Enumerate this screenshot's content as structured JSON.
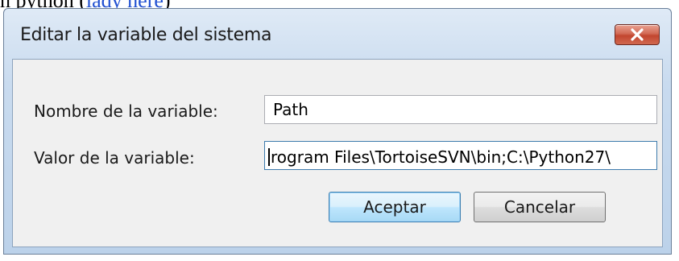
{
  "background": {
    "text_before": "n python (",
    "link_text": "lady here",
    "text_after": ")"
  },
  "dialog": {
    "title": "Editar la variable del sistema",
    "fields": {
      "name_label": "Nombre de la variable:",
      "name_value": "Path",
      "value_label": "Valor de la variable:",
      "value_value": "rogram Files\\TortoiseSVN\\bin;C:\\Python27\\"
    },
    "buttons": {
      "accept": "Aceptar",
      "cancel": "Cancelar"
    }
  },
  "colors": {
    "close_button": "#c2462f",
    "default_button_border": "#3c7fb1"
  },
  "icons": {
    "close": "close-icon"
  }
}
